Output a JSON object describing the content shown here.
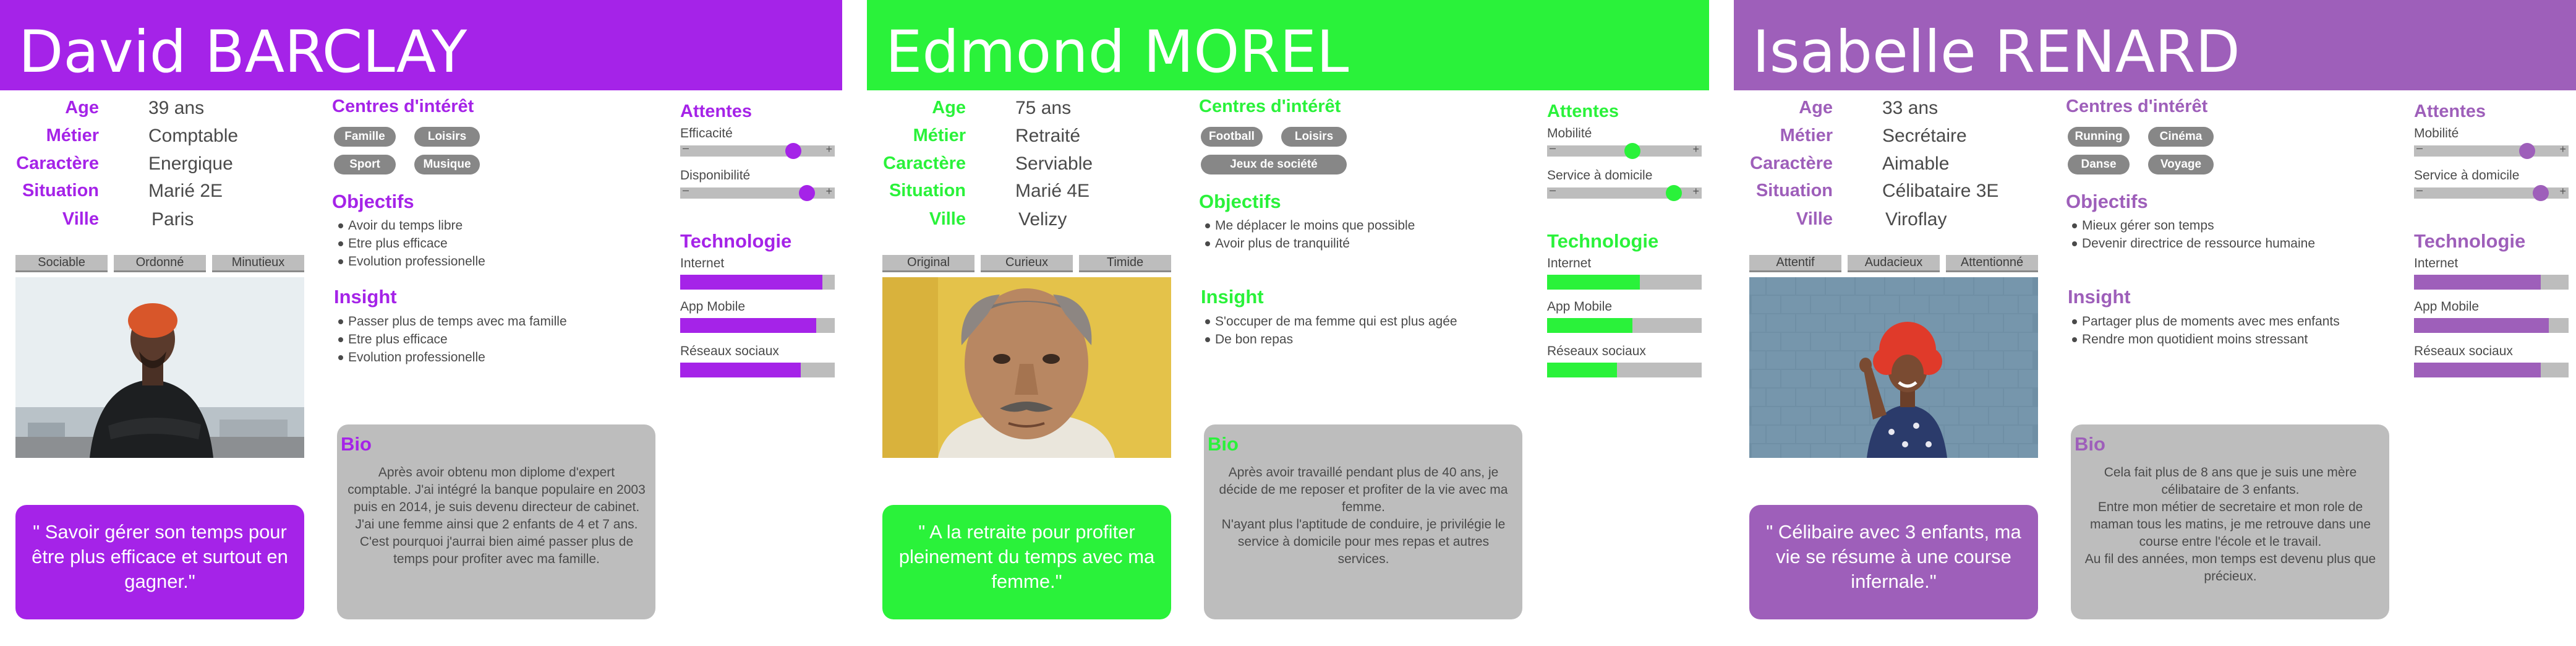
{
  "personas": [
    {
      "name": "David BARCLAY",
      "accent": "#a523e8",
      "info": [
        {
          "label": "Age",
          "value": "39 ans"
        },
        {
          "label": "Métier",
          "value": "Comptable"
        },
        {
          "label": "Caractère",
          "value": "Energique"
        },
        {
          "label": "Situation",
          "value": "Marié 2E"
        },
        {
          "label": "Ville",
          "value": "Paris"
        }
      ],
      "interests_title": "Centres d'intérêt",
      "interests": [
        "Famille",
        "Loisirs",
        "Sport",
        "Musique"
      ],
      "objectives_title": "Objectifs",
      "objectives": [
        "Avoir du temps libre",
        "Etre plus efficace",
        "Evolution professionelle"
      ],
      "insight_title": "Insight",
      "insight": [
        "Passer plus de temps avec ma famille",
        "Etre plus efficace",
        "Evolution professionelle"
      ],
      "traits": [
        "Sociable",
        "Ordonné",
        "Minutieux"
      ],
      "photo_icon": "man-with-orange-beanie-photo",
      "quote": "\" Savoir gérer son temps pour être plus efficace et surtout en gagner.\"",
      "bio_title": "Bio",
      "bio": "Après avoir obtenu mon diplome d'expert comptable. J'ai intégré la banque populaire en 2003 puis en 2014, je suis devenu directeur de cabinet.\nJ'ai une femme ainsi que 2 enfants de 4 et 7 ans. C'est pourquoi j'aurrai bien aimé passer plus de temps pour profiter avec ma famille.",
      "expectations_title": "Attentes",
      "expectations": [
        {
          "label": "Efficacité",
          "level": 0.73
        },
        {
          "label": "Disponibilité",
          "level": 0.82
        }
      ],
      "tech_title": "Technologie",
      "tech": [
        {
          "label": "Internet",
          "level": 0.92
        },
        {
          "label": "App Mobile",
          "level": 0.88
        },
        {
          "label": "Réseaux sociaux",
          "level": 0.78
        }
      ]
    },
    {
      "name": "Edmond MOREL",
      "accent": "#2af23a",
      "info": [
        {
          "label": "Age",
          "value": "75 ans"
        },
        {
          "label": "Métier",
          "value": "Retraité"
        },
        {
          "label": "Caractère",
          "value": "Serviable"
        },
        {
          "label": "Situation",
          "value": "Marié 4E"
        },
        {
          "label": "Ville",
          "value": "Velizy"
        }
      ],
      "interests_title": "Centres d'intérêt",
      "interests": [
        "Football",
        "Loisirs",
        "Jeux de société"
      ],
      "objectives_title": "Objectifs",
      "objectives": [
        "Me déplacer le moins que possible",
        "Avoir plus de tranquilité"
      ],
      "insight_title": "Insight",
      "insight": [
        "S'occuper de ma femme qui est plus agée",
        "De bon repas"
      ],
      "traits": [
        "Original",
        "Curieux",
        "Timide"
      ],
      "photo_icon": "old-man-with-mustache-photo",
      "quote": "\" A la retraite pour profiter pleinement du temps avec ma femme.\"",
      "bio_title": "Bio",
      "bio": "Après avoir travaillé pendant plus de 40 ans, je décide de me reposer et profiter de la vie avec ma femme.\nN'ayant plus l'aptitude de conduire, je privilégie le service à domicile pour mes repas et autres services.",
      "expectations_title": "Attentes",
      "expectations": [
        {
          "label": "Mobilité",
          "level": 0.55
        },
        {
          "label": "Service à domicile",
          "level": 0.82
        }
      ],
      "tech_title": "Technologie",
      "tech": [
        {
          "label": "Internet",
          "level": 0.6
        },
        {
          "label": "App Mobile",
          "level": 0.55
        },
        {
          "label": "Réseaux sociaux",
          "level": 0.45
        }
      ]
    },
    {
      "name": "Isabelle RENARD",
      "accent": "#9e5fba",
      "info": [
        {
          "label": "Age",
          "value": "33 ans"
        },
        {
          "label": "Métier",
          "value": "Secrétaire"
        },
        {
          "label": "Caractère",
          "value": "Aimable"
        },
        {
          "label": "Situation",
          "value": "Célibataire 3E"
        },
        {
          "label": "Ville",
          "value": "Viroflay"
        }
      ],
      "interests_title": "Centres d'intérêt",
      "interests": [
        "Running",
        "Cinéma",
        "Danse",
        "Voyage"
      ],
      "objectives_title": "Objectifs",
      "objectives": [
        "Mieux gérer son temps",
        "Devenir directrice de ressource humaine"
      ],
      "insight_title": "Insight",
      "insight": [
        "Partager plus de moments avec mes enfants",
        "Rendre mon quotidient moins stressant"
      ],
      "traits": [
        "Attentif",
        "Audacieux",
        "Attentionné"
      ],
      "photo_icon": "woman-with-red-curly-hair-photo",
      "quote": "\" Célibaire avec 3 enfants, ma vie se résume à une course infernale.\"",
      "bio_title": "Bio",
      "bio": "Cela fait plus de 8 ans que je suis une mère célibataire de 3 enfants.\nEntre mon métier de secretaire et mon role de maman tous les matins, je me retrouve dans une course entre l'école et le travail.\nAu fil des années, mon temps est devenu plus que précieux.",
      "expectations_title": "Attentes",
      "expectations": [
        {
          "label": "Mobilité",
          "level": 0.73
        },
        {
          "label": "Service à domicile",
          "level": 0.82
        }
      ],
      "tech_title": "Technologie",
      "tech": [
        {
          "label": "Internet",
          "level": 0.82
        },
        {
          "label": "App Mobile",
          "level": 0.87
        },
        {
          "label": "Réseaux sociaux",
          "level": 0.82
        }
      ]
    }
  ]
}
